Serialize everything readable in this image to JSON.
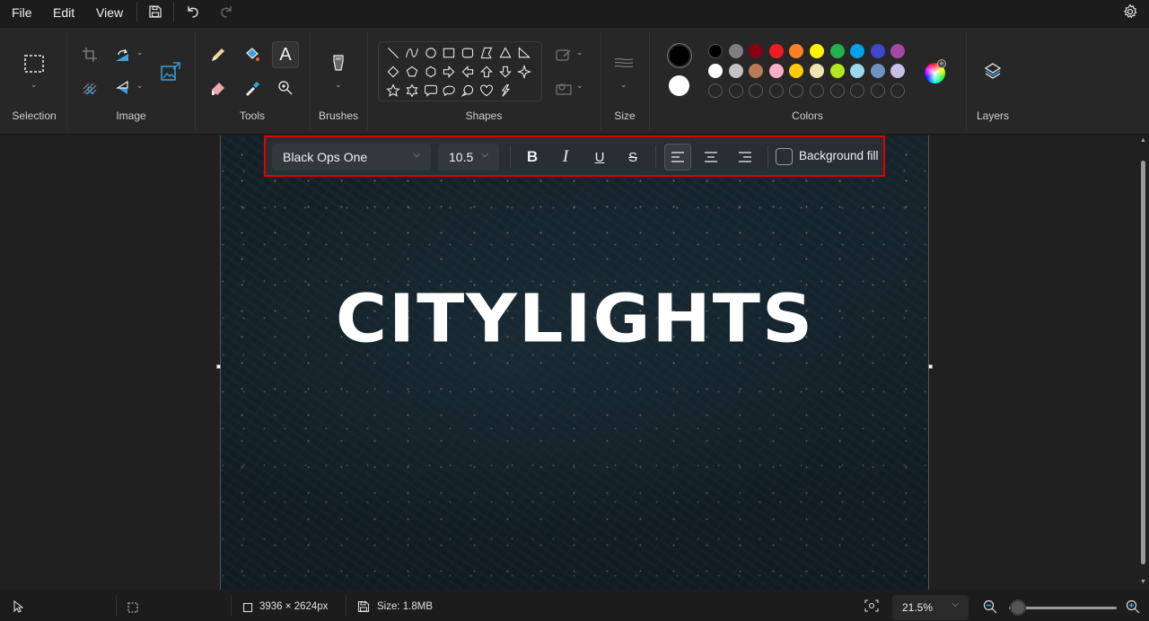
{
  "menu": {
    "items": [
      {
        "label": "File"
      },
      {
        "label": "Edit"
      },
      {
        "label": "View"
      }
    ],
    "icons": [
      "save-icon",
      "undo-icon",
      "redo-icon",
      "settings-icon"
    ]
  },
  "ribbon": {
    "groups": {
      "selection": "Selection",
      "image": "Image",
      "tools": "Tools",
      "brushes": "Brushes",
      "shapes": "Shapes",
      "size": "Size",
      "colors": "Colors",
      "layers": "Layers"
    },
    "active_tool": "text-tool",
    "shapes": [
      "line",
      "curve",
      "oval",
      "rectangle",
      "rounded-rectangle",
      "polygon",
      "triangle",
      "right-triangle",
      "diamond",
      "pentagon",
      "hexagon",
      "right-arrow",
      "left-arrow",
      "up-arrow",
      "down-arrow",
      "four-point-star",
      "five-point-star",
      "six-point-star",
      "rounded-callout",
      "oval-callout",
      "cloud-callout",
      "heart",
      "lightning"
    ],
    "colors": {
      "primary": "#000000",
      "secondary": "#ffffff",
      "row1": [
        "#000000",
        "#7f7f7f",
        "#880015",
        "#ed1c24",
        "#ff7f27",
        "#fff200",
        "#22b14c",
        "#00a2e8",
        "#3f48cc",
        "#a349a4"
      ],
      "row2": [
        "#ffffff",
        "#c3c3c3",
        "#b97a57",
        "#ffaec9",
        "#ffc90e",
        "#efe4b0",
        "#b5e61d",
        "#99d9ea",
        "#7092be",
        "#c8bfe7"
      ],
      "custom_slots": 10
    }
  },
  "text_toolbar": {
    "font_family": "Black Ops One",
    "font_size": "10.5",
    "bold_label": "B",
    "italic_label": "I",
    "underline_label": "U",
    "strike_label": "S",
    "alignment": "left",
    "background_fill_label": "Background fill",
    "background_fill_checked": false,
    "highlight_color": "#e00000"
  },
  "canvas": {
    "text": "CITYLIGHTS"
  },
  "status": {
    "dimensions": "3936 × 2624px",
    "size": "Size: 1.8MB",
    "zoom": "21.5%",
    "zoom_slider_fraction": 0.02
  }
}
